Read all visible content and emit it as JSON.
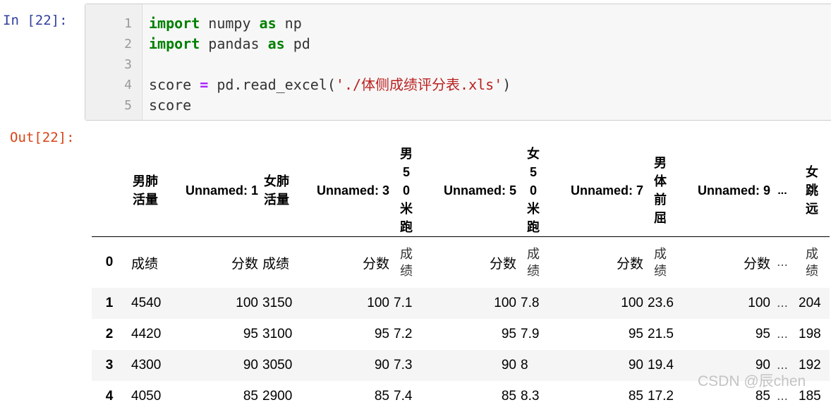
{
  "cell": {
    "in_prompt": "In  [22]:",
    "out_prompt": "Out[22]:",
    "lines": [
      {
        "n": "1",
        "html_parts": [
          {
            "t": "import",
            "c": "kw"
          },
          {
            "t": " numpy ",
            "c": ""
          },
          {
            "t": "as",
            "c": "kw"
          },
          {
            "t": " np",
            "c": ""
          }
        ]
      },
      {
        "n": "2",
        "html_parts": [
          {
            "t": "import",
            "c": "kw"
          },
          {
            "t": " pandas ",
            "c": ""
          },
          {
            "t": "as",
            "c": "kw"
          },
          {
            "t": " pd",
            "c": ""
          }
        ]
      },
      {
        "n": "3",
        "html_parts": []
      },
      {
        "n": "4",
        "html_parts": [
          {
            "t": "score ",
            "c": ""
          },
          {
            "t": "=",
            "c": "op"
          },
          {
            "t": " pd.read_excel(",
            "c": ""
          },
          {
            "t": "'./体侧成绩评分表.xls'",
            "c": "str"
          },
          {
            "t": ")",
            "c": ""
          }
        ]
      },
      {
        "n": "5",
        "html_parts": [
          {
            "t": "score",
            "c": ""
          }
        ]
      }
    ]
  },
  "table": {
    "columns": [
      {
        "label": "男肺活量",
        "style": "wrap2"
      },
      {
        "label": "Unnamed: 1",
        "style": "unnamed"
      },
      {
        "label": "女肺活量",
        "style": "wrap2"
      },
      {
        "label": "Unnamed: 3",
        "style": "unnamed"
      },
      {
        "label": "男50米跑",
        "style": "stack"
      },
      {
        "label": "Unnamed: 5",
        "style": "unnamed"
      },
      {
        "label": "女50米跑",
        "style": "stack"
      },
      {
        "label": "Unnamed: 7",
        "style": "unnamed"
      },
      {
        "label": "男体前屈",
        "style": "stack"
      },
      {
        "label": "Unnamed: 9",
        "style": "unnamed"
      },
      {
        "label": "...",
        "style": "ellipsis"
      },
      {
        "label": "女跳远",
        "style": "stack"
      }
    ],
    "rows": [
      {
        "index": "0",
        "cells": [
          "成绩",
          "分数",
          "成绩",
          "分数",
          "成绩",
          "分数",
          "成绩",
          "分数",
          "成绩",
          "分数",
          "...",
          "成绩"
        ]
      },
      {
        "index": "1",
        "cells": [
          "4540",
          "100",
          "3150",
          "100",
          "7.1",
          "100",
          "7.8",
          "100",
          "23.6",
          "100",
          "...",
          "204"
        ]
      },
      {
        "index": "2",
        "cells": [
          "4420",
          "95",
          "3100",
          "95",
          "7.2",
          "95",
          "7.9",
          "95",
          "21.5",
          "95",
          "...",
          "198"
        ]
      },
      {
        "index": "3",
        "cells": [
          "4300",
          "90",
          "3050",
          "90",
          "7.3",
          "90",
          "8",
          "90",
          "19.4",
          "90",
          "...",
          "192"
        ]
      },
      {
        "index": "4",
        "cells": [
          "4050",
          "85",
          "2900",
          "85",
          "7.4",
          "85",
          "8.3",
          "85",
          "17.2",
          "85",
          "...",
          "185"
        ]
      }
    ]
  },
  "watermark": "CSDN @辰chen"
}
